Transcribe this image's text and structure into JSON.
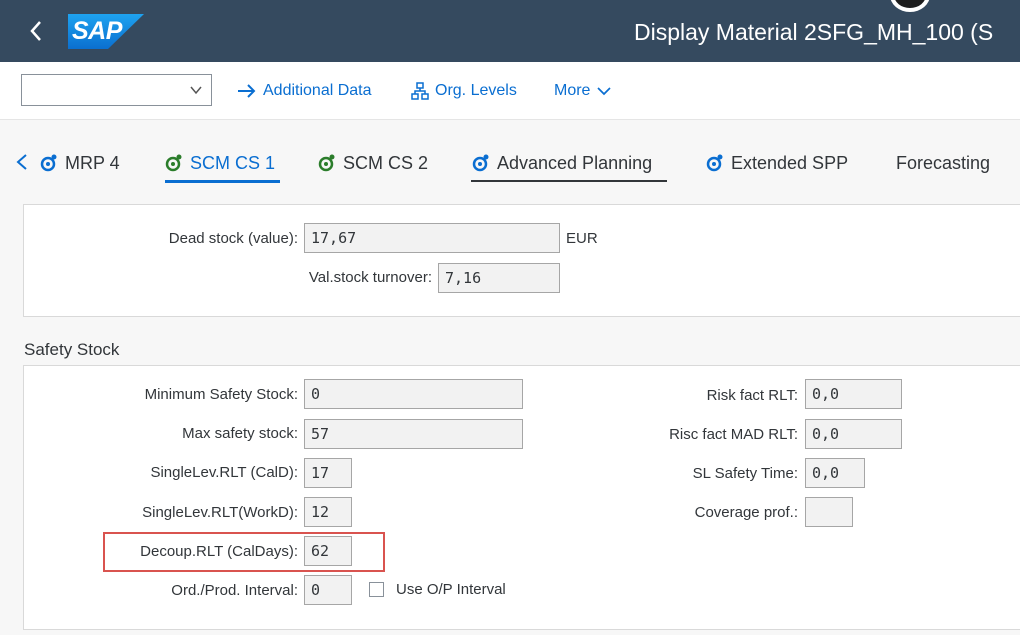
{
  "shell": {
    "back_icon": "chevron-left-icon",
    "logo_text": "SAP",
    "title": "Display Material 2SFG_MH_100 (S"
  },
  "toolbar": {
    "select_value": "",
    "additional_data": "Additional Data",
    "org_levels": "Org. Levels",
    "more": "More"
  },
  "tabs": [
    {
      "label": "MRP 4",
      "icon": "tab-settings-icon"
    },
    {
      "label": "SCM CS 1",
      "icon": "tab-settings-icon",
      "active": true
    },
    {
      "label": "SCM CS 2",
      "icon": "tab-settings-icon"
    },
    {
      "label": "Advanced Planning",
      "icon": "tab-settings-icon"
    },
    {
      "label": "Extended SPP",
      "icon": "tab-settings-icon"
    },
    {
      "label": "Forecasting"
    }
  ],
  "stock_panel": {
    "dead_stock_label": "Dead stock (value):",
    "dead_stock_value": "17,67",
    "dead_stock_unit": "EUR",
    "turnover_label": "Val.stock turnover:",
    "turnover_value": "7,16"
  },
  "safety_stock": {
    "title": "Safety Stock",
    "min_safety_label": "Minimum Safety Stock:",
    "min_safety_value": "0",
    "max_safety_label": "Max safety stock:",
    "max_safety_value": "57",
    "singlelev_cald_label": "SingleLev.RLT (CalD):",
    "singlelev_cald_value": "17",
    "singlelev_workd_label": "SingleLev.RLT(WorkD):",
    "singlelev_workd_value": "12",
    "decoup_label": "Decoup.RLT (CalDays):",
    "decoup_value": "62",
    "ordprod_label": "Ord./Prod. Interval:",
    "ordprod_value": "0",
    "use_op_label": "Use O/P Interval",
    "risk_rlt_label": "Risk fact RLT:",
    "risk_rlt_value": "0,0",
    "risc_mad_label": "Risc fact MAD RLT:",
    "risc_mad_value": "0,0",
    "sl_safety_label": "SL Safety Time:",
    "sl_safety_value": "0,0",
    "coverage_label": "Coverage prof.:",
    "coverage_value": ""
  },
  "colors": {
    "shell_bg": "#354a5f",
    "accent": "#0a6ed1",
    "highlight": "#d9534f"
  }
}
